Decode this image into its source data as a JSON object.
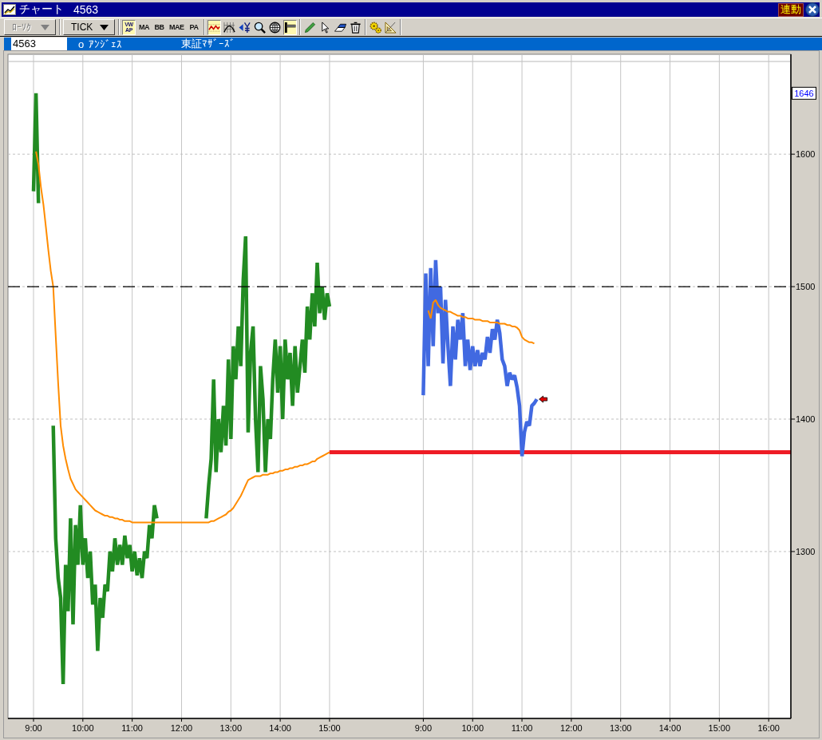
{
  "window": {
    "title": "チャート",
    "code": "4563",
    "link_badge": "連動"
  },
  "toolbar": {
    "dropdowns": [
      {
        "label": "ﾛｰｿｸ",
        "disabled": true
      },
      {
        "label": "TICK",
        "disabled": false
      }
    ],
    "indicators": [
      {
        "label": "VWAP",
        "selected": true
      },
      {
        "label": "MA",
        "selected": false
      },
      {
        "label": "BB",
        "selected": false
      },
      {
        "label": "MAE",
        "selected": false
      },
      {
        "label": "PA",
        "selected": false
      }
    ],
    "chart_tools": [
      {
        "selected": true
      },
      {
        "selected": false
      },
      {
        "selected": false
      },
      {
        "selected": false
      },
      {
        "selected": false
      },
      {
        "selected": true
      }
    ]
  },
  "symbol_bar": {
    "code": "4563",
    "mark": "o",
    "name": "ｱﾝｼﾞｪｽ",
    "market": "東証ﾏｻﾞｰｽﾞ"
  },
  "chart": {
    "price_tag": "1646",
    "chart_data": {
      "type": "line",
      "grid": true,
      "categories": [
        "9:00",
        null,
        null,
        null,
        null,
        null,
        null,
        null,
        null,
        null,
        null,
        null,
        null,
        null,
        null,
        null,
        null,
        null,
        null,
        null,
        "10:00",
        null,
        null,
        null,
        null,
        null,
        null,
        null,
        null,
        null,
        null,
        null,
        null,
        null,
        null,
        null,
        null,
        null,
        null,
        null,
        "11:00",
        null,
        null,
        null,
        null,
        null,
        null,
        null,
        null,
        null,
        null,
        null,
        null,
        null,
        null,
        null,
        null,
        null,
        null,
        null,
        "12:00",
        null,
        null,
        null,
        null,
        null,
        null,
        null,
        null,
        null,
        null,
        null,
        null,
        null,
        null,
        null,
        null,
        null,
        null,
        null,
        "13:00",
        null,
        null,
        null,
        null,
        null,
        null,
        null,
        null,
        null,
        null,
        null,
        null,
        null,
        null,
        null,
        null,
        null,
        null,
        null,
        "14:00",
        null,
        null,
        null,
        null,
        null,
        null,
        null,
        null,
        null,
        null,
        null,
        null,
        null,
        null,
        null,
        null,
        null,
        null,
        null,
        "15:00",
        null,
        null,
        null,
        null,
        null,
        null,
        null,
        null,
        null,
        null,
        null,
        null,
        null,
        null,
        null,
        null,
        null,
        null,
        null,
        null,
        null,
        null,
        null,
        null,
        null,
        null,
        null,
        null,
        null,
        null,
        null,
        null,
        null,
        null,
        null,
        null,
        null,
        "9:00",
        null,
        null,
        null,
        null,
        null,
        null,
        null,
        null,
        null,
        null,
        null,
        null,
        null,
        null,
        null,
        null,
        null,
        null,
        null,
        "10:00",
        null,
        null,
        null,
        null,
        null,
        null,
        null,
        null,
        null,
        null,
        null,
        null,
        null,
        null,
        null,
        null,
        null,
        null,
        null,
        "11:00",
        null,
        null,
        null,
        null,
        null,
        null,
        null,
        null,
        null,
        null,
        null,
        null,
        null,
        null,
        null,
        null,
        null,
        null,
        null,
        "12:00",
        null,
        null,
        null,
        null,
        null,
        null,
        null,
        null,
        null,
        null,
        null,
        null,
        null,
        null,
        null,
        null,
        null,
        null,
        null,
        "13:00",
        null,
        null,
        null,
        null,
        null,
        null,
        null,
        null,
        null,
        null,
        null,
        null,
        null,
        null,
        null,
        null,
        null,
        null,
        null,
        "14:00",
        null,
        null,
        null,
        null,
        null,
        null,
        null,
        null,
        null,
        null,
        null,
        null,
        null,
        null,
        null,
        null,
        null,
        null,
        null,
        "15:00",
        null,
        null,
        null,
        null,
        null,
        null,
        null,
        null,
        null,
        null,
        null,
        null,
        null,
        null,
        null,
        null,
        null,
        null,
        null,
        "16:00",
        null,
        null,
        null,
        null,
        null,
        null,
        null,
        null,
        null
      ],
      "ylim": [
        1174,
        1670
      ],
      "yticks": [
        1300,
        1400,
        1500,
        1600
      ],
      "series": [
        {
          "color": "#228b22",
          "values": [
            1572,
            1646,
            1563,
            null,
            null,
            null,
            null,
            null,
            1395,
            1310,
            1280,
            1265,
            1200,
            1290,
            1255,
            1325,
            1245,
            1320,
            1290,
            1335,
            1290,
            1310,
            1280,
            1300,
            1260,
            1275,
            1225,
            1265,
            1250,
            1275,
            1270,
            1300,
            1285,
            1310,
            1290,
            1305,
            1290,
            1312,
            1295,
            1305,
            1285,
            1300,
            1282,
            1295,
            1280,
            1300,
            1295,
            1320,
            1310,
            1335,
            1325,
            null,
            null,
            null,
            null,
            null,
            null,
            null,
            null,
            null,
            null,
            null,
            null,
            null,
            null,
            null,
            null,
            null,
            null,
            null,
            1325,
            1350,
            1370,
            1430,
            1360,
            1400,
            1375,
            1410,
            1380,
            1445,
            1385,
            1455,
            1430,
            1470,
            1440,
            1505,
            1538,
            1390,
            1450,
            1470,
            1400,
            1360,
            1440,
            1415,
            1360,
            1400,
            1385,
            1430,
            1460,
            1420,
            1455,
            1400,
            1460,
            1430,
            1450,
            1410,
            1455,
            1420,
            1440,
            1460,
            1435,
            1485,
            1460,
            1495,
            1470,
            1518,
            1480,
            1500,
            1475,
            1495,
            1485,
            null,
            null,
            null,
            null,
            null,
            null,
            null,
            null,
            null,
            null,
            null,
            null,
            null,
            null,
            null,
            null,
            null,
            null,
            null,
            null,
            null,
            null,
            null,
            null,
            null,
            null,
            null,
            null,
            null,
            null,
            null,
            null,
            null,
            null,
            null,
            null,
            null,
            null,
            null,
            null,
            null,
            null,
            null,
            null,
            null,
            null,
            null,
            null,
            null,
            null,
            null,
            null,
            null,
            null,
            null,
            null,
            null,
            null,
            null,
            null,
            null,
            null,
            null,
            null,
            null,
            null,
            null,
            null,
            null,
            null,
            null,
            null,
            null,
            null,
            null,
            null,
            null,
            null,
            null,
            null,
            null,
            null,
            null,
            null,
            null,
            null,
            null,
            null,
            null,
            null,
            null,
            null,
            null,
            null,
            null,
            null,
            null,
            null,
            null,
            null,
            null,
            null,
            null,
            null,
            null,
            null,
            null,
            null,
            null,
            null,
            null,
            null,
            null,
            null,
            null,
            null,
            null,
            null,
            null,
            null,
            null,
            null,
            null,
            null,
            null,
            null,
            null,
            null,
            null,
            null,
            null,
            null,
            null,
            null,
            null,
            null,
            null,
            null,
            null,
            null,
            null,
            null,
            null,
            null,
            null,
            null,
            null,
            null,
            null,
            null,
            null,
            null,
            null,
            null,
            null,
            null,
            null,
            null,
            null,
            null,
            null,
            null,
            null,
            null,
            null,
            null,
            null,
            null,
            null,
            null,
            null,
            null,
            null,
            null,
            null,
            null,
            null,
            null,
            null,
            null,
            null,
            null,
            null,
            null,
            null,
            null,
            null
          ]
        },
        {
          "color": "#4169e1",
          "values": [
            null,
            null,
            null,
            null,
            null,
            null,
            null,
            null,
            null,
            null,
            null,
            null,
            null,
            null,
            null,
            null,
            null,
            null,
            null,
            null,
            null,
            null,
            null,
            null,
            null,
            null,
            null,
            null,
            null,
            null,
            null,
            null,
            null,
            null,
            null,
            null,
            null,
            null,
            null,
            null,
            null,
            null,
            null,
            null,
            null,
            null,
            null,
            null,
            null,
            null,
            null,
            null,
            null,
            null,
            null,
            null,
            null,
            null,
            null,
            null,
            null,
            null,
            null,
            null,
            null,
            null,
            null,
            null,
            null,
            null,
            null,
            null,
            null,
            null,
            null,
            null,
            null,
            null,
            null,
            null,
            null,
            null,
            null,
            null,
            null,
            null,
            null,
            null,
            null,
            null,
            null,
            null,
            null,
            null,
            null,
            null,
            null,
            null,
            null,
            null,
            null,
            null,
            null,
            null,
            null,
            null,
            null,
            null,
            null,
            null,
            null,
            null,
            null,
            null,
            null,
            null,
            null,
            null,
            null,
            null,
            null,
            null,
            null,
            null,
            null,
            null,
            null,
            null,
            null,
            null,
            null,
            null,
            null,
            null,
            null,
            null,
            null,
            null,
            null,
            null,
            null,
            null,
            null,
            null,
            null,
            null,
            null,
            null,
            null,
            null,
            null,
            null,
            null,
            null,
            null,
            null,
            null,
            null,
            1418,
            1510,
            1440,
            1514,
            1455,
            1520,
            1480,
            1500,
            1442,
            1490,
            1455,
            1425,
            1470,
            1445,
            1475,
            1460,
            1480,
            1440,
            1460,
            1437,
            1455,
            1440,
            1452,
            1440,
            1450,
            1445,
            1462,
            1450,
            1468,
            1460,
            1475,
            1465,
            1445,
            1440,
            1425,
            1435,
            1430,
            1433,
            1424,
            1410,
            1372,
            1390,
            1398,
            1395,
            1410,
            1412,
            1415,
            null,
            null,
            null,
            null,
            null,
            null,
            null,
            null,
            null,
            null,
            null,
            null,
            null,
            null,
            null,
            null,
            null,
            null,
            null,
            null,
            null,
            null,
            null,
            null,
            null,
            null,
            null,
            null,
            null,
            null,
            null,
            null,
            null,
            null,
            null,
            null,
            null,
            null,
            null,
            null,
            null,
            null,
            null,
            null,
            null,
            null,
            null,
            null,
            null,
            null,
            null,
            null,
            null,
            null,
            null,
            null,
            null,
            null,
            null,
            null,
            null,
            null,
            null,
            null,
            null,
            null,
            null,
            null,
            null,
            null,
            null,
            null,
            null,
            null,
            null,
            null,
            null,
            null,
            null,
            null,
            null,
            null,
            null,
            null,
            null,
            null,
            null,
            null,
            null,
            null,
            null,
            null,
            null,
            null,
            null,
            null,
            null,
            null,
            null,
            null,
            null,
            null,
            null
          ]
        },
        {
          "color": "#ff8c00",
          "values": [
            null,
            1602,
            1592,
            1575,
            1562,
            1545,
            1528,
            1512,
            1500,
            1463,
            1427,
            1395,
            1380,
            1370,
            1362,
            1355,
            1351,
            1347,
            1345,
            1343,
            1341,
            1339,
            1337,
            1335,
            1333,
            1331,
            1330,
            1329,
            1328,
            1327,
            1327,
            1326,
            1326,
            1325,
            1325,
            1324,
            1324,
            1323,
            1323,
            1323,
            1322,
            1322,
            1322,
            1322,
            1322,
            1322,
            1322,
            1322,
            1322,
            1322,
            1322,
            1322,
            1322,
            1322,
            1322,
            1322,
            1322,
            1322,
            1322,
            1322,
            1322,
            1322,
            1322,
            1322,
            1322,
            1322,
            1322,
            1322,
            1322,
            1322,
            1322,
            1322,
            1323,
            1323,
            1324,
            1325,
            1326,
            1327,
            1328,
            1330,
            1331,
            1333,
            1336,
            1339,
            1342,
            1346,
            1350,
            1354,
            1355,
            1356,
            1357,
            1357,
            1357,
            1358,
            1358,
            1358,
            1359,
            1359,
            1360,
            1360,
            1361,
            1361,
            1362,
            1362,
            1363,
            1363,
            1364,
            1364,
            1365,
            1365,
            1366,
            1366,
            1367,
            1368,
            1368,
            1370,
            1371,
            1372,
            1373,
            1374,
            1375,
            null,
            null,
            null,
            null,
            null,
            null,
            null,
            null,
            null,
            null,
            null,
            null,
            null,
            null,
            null,
            null,
            null,
            null,
            null,
            null,
            null,
            null,
            null,
            null,
            null,
            null,
            null,
            null,
            null,
            null,
            null,
            null,
            null,
            null,
            null,
            null,
            null,
            null,
            null,
            1482,
            1476,
            1488,
            1490,
            1486,
            1484,
            1483,
            1482,
            1481,
            1481,
            1480,
            1479,
            1478,
            1478,
            1477,
            1477,
            1476,
            1476,
            1476,
            1475,
            1475,
            1475,
            1474,
            1474,
            1474,
            1473,
            1473,
            1473,
            1473,
            1472,
            1472,
            1472,
            1471,
            1471,
            1470,
            1470,
            1469,
            1467,
            1462,
            1460,
            1459,
            1458,
            1458,
            1457,
            null,
            null,
            null,
            null,
            null,
            null,
            null,
            null,
            null,
            null,
            null,
            null,
            null,
            null,
            null,
            null,
            null,
            null,
            null,
            null,
            null,
            null,
            null,
            null,
            null,
            null,
            null,
            null,
            null,
            null,
            null,
            null,
            null,
            null,
            null,
            null,
            null,
            null,
            null,
            null,
            null,
            null,
            null,
            null,
            null,
            null,
            null,
            null,
            null,
            null,
            null,
            null,
            null,
            null,
            null,
            null,
            null,
            null,
            null,
            null,
            null,
            null,
            null,
            null,
            null,
            null,
            null,
            null,
            null,
            null,
            null,
            null,
            null,
            null,
            null,
            null,
            null,
            null,
            null,
            null,
            null,
            null,
            null,
            null,
            null,
            null,
            null,
            null,
            null,
            null,
            null,
            null,
            null,
            null,
            null,
            null,
            null,
            null,
            null,
            null,
            null,
            null,
            null,
            null
          ]
        },
        {
          "color": "#ee1c25",
          "values": [
            null,
            null,
            null,
            null,
            null,
            null,
            null,
            null,
            null,
            null,
            null,
            null,
            null,
            null,
            null,
            null,
            null,
            null,
            null,
            null,
            null,
            null,
            null,
            null,
            null,
            null,
            null,
            null,
            null,
            null,
            null,
            null,
            null,
            null,
            null,
            null,
            null,
            null,
            null,
            null,
            null,
            null,
            null,
            null,
            null,
            null,
            null,
            null,
            null,
            null,
            null,
            null,
            null,
            null,
            null,
            null,
            null,
            null,
            null,
            null,
            null,
            null,
            null,
            null,
            null,
            null,
            null,
            null,
            null,
            null,
            null,
            null,
            null,
            null,
            null,
            null,
            null,
            null,
            null,
            null,
            null,
            null,
            null,
            null,
            null,
            null,
            null,
            null,
            null,
            null,
            null,
            null,
            null,
            null,
            null,
            null,
            null,
            null,
            null,
            null,
            null,
            null,
            null,
            null,
            null,
            null,
            null,
            null,
            null,
            null,
            null,
            null,
            null,
            null,
            null,
            null,
            null,
            null,
            null,
            null,
            1375,
            1375,
            1375,
            1375,
            1375,
            1375,
            1375,
            1375,
            1375,
            1375,
            1375,
            1375,
            1375,
            1375,
            1375,
            1375,
            1375,
            1375,
            1375,
            1375,
            1375,
            1375,
            1375,
            1375,
            1375,
            1375,
            1375,
            1375,
            1375,
            1375,
            1375,
            1375,
            1375,
            1375,
            1375,
            1375,
            1375,
            1375,
            1375,
            1375,
            1375,
            1375,
            1375,
            1375,
            1375,
            1375,
            1375,
            1375,
            1375,
            1375,
            1375,
            1375,
            1375,
            1375,
            1375,
            1375,
            1375,
            1375,
            1375,
            1375,
            1375,
            1375,
            1375,
            1375,
            1375,
            1375,
            1375,
            1375,
            1375,
            1375,
            1375,
            1375,
            1375,
            1375,
            1375,
            1375,
            1375,
            1375,
            1375,
            1375,
            1375,
            1375,
            1375,
            1375,
            1375,
            1375,
            1375,
            1375,
            1375,
            1375,
            1375,
            1375,
            1375,
            1375,
            1375,
            1375,
            1375,
            1375,
            1375,
            1375,
            1375,
            1375,
            1375,
            1375,
            1375,
            1375,
            1375,
            1375,
            1375,
            1375,
            1375,
            1375,
            1375,
            1375,
            1375,
            1375,
            1375,
            1375,
            1375,
            1375,
            1375,
            1375,
            1375,
            1375,
            1375,
            1375,
            1375,
            1375,
            1375,
            1375,
            1375,
            1375,
            1375,
            1375,
            1375,
            1375,
            1375,
            1375,
            1375,
            1375,
            1375,
            1375,
            1375,
            1375,
            1375,
            1375,
            1375,
            1375,
            1375,
            1375,
            1375,
            1375,
            1375,
            1375,
            1375,
            1375,
            1375,
            1375,
            1375,
            1375,
            1375,
            1375,
            1375,
            1375,
            1375,
            1375,
            1375,
            1375,
            1375,
            1375,
            1375,
            1375,
            1375,
            1375,
            1375,
            1375,
            1375,
            1375,
            1375,
            1375,
            1375,
            1375,
            1375,
            1375,
            1375,
            1375,
            1375,
            1375
          ]
        },
        {
          "color": "#000000",
          "line_style": "dashed",
          "values": [
            1500,
            1500,
            1500,
            1500,
            1500,
            1500,
            1500,
            1500,
            1500,
            1500,
            1500,
            1500,
            1500,
            1500,
            1500,
            1500,
            1500,
            1500,
            1500,
            1500,
            1500,
            1500,
            1500,
            1500,
            1500,
            1500,
            1500,
            1500,
            1500,
            1500,
            1500,
            1500,
            1500,
            1500,
            1500,
            1500,
            1500,
            1500,
            1500,
            1500,
            1500,
            1500,
            1500,
            1500,
            1500,
            1500,
            1500,
            1500,
            1500,
            1500,
            1500,
            1500,
            1500,
            1500,
            1500,
            1500,
            1500,
            1500,
            1500,
            1500,
            1500,
            1500,
            1500,
            1500,
            1500,
            1500,
            1500,
            1500,
            1500,
            1500,
            1500,
            1500,
            1500,
            1500,
            1500,
            1500,
            1500,
            1500,
            1500,
            1500,
            1500,
            1500,
            1500,
            1500,
            1500,
            1500,
            1500,
            1500,
            1500,
            1500,
            1500,
            1500,
            1500,
            1500,
            1500,
            1500,
            1500,
            1500,
            1500,
            1500,
            1500,
            1500,
            1500,
            1500,
            1500,
            1500,
            1500,
            1500,
            1500,
            1500,
            1500,
            1500,
            1500,
            1500,
            1500,
            1500,
            1500,
            1500,
            1500,
            1500,
            1500,
            1500,
            1500,
            1500,
            1500,
            1500,
            1500,
            1500,
            1500,
            1500,
            1500,
            1500,
            1500,
            1500,
            1500,
            1500,
            1500,
            1500,
            1500,
            1500,
            1500,
            1500,
            1500,
            1500,
            1500,
            1500,
            1500,
            1500,
            1500,
            1500,
            1500,
            1500,
            1500,
            1500,
            1500,
            1500,
            1500,
            1500,
            1500,
            1500,
            1500,
            1500,
            1500,
            1500,
            1500,
            1500,
            1500,
            1500,
            1500,
            1500,
            1500,
            1500,
            1500,
            1500,
            1500,
            1500,
            1500,
            1500,
            1500,
            1500,
            1500,
            1500,
            1500,
            1500,
            1500,
            1500,
            1500,
            1500,
            1500,
            1500,
            1500,
            1500,
            1500,
            1500,
            1500,
            1500,
            1500,
            1500,
            1500,
            1500,
            1500,
            1500,
            1500,
            1500,
            1500,
            1500,
            1500,
            1500,
            1500,
            1500,
            1500,
            1500,
            1500,
            1500,
            1500,
            1500,
            1500,
            1500,
            1500,
            1500,
            1500,
            1500,
            1500,
            1500,
            1500,
            1500,
            1500,
            1500,
            1500,
            1500,
            1500,
            1500,
            1500,
            1500,
            1500,
            1500,
            1500,
            1500,
            1500,
            1500,
            1500,
            1500,
            1500,
            1500,
            1500,
            1500,
            1500,
            1500,
            1500,
            1500,
            1500,
            1500,
            1500,
            1500,
            1500,
            1500,
            1500,
            1500,
            1500,
            1500,
            1500,
            1500,
            1500,
            1500,
            1500,
            1500,
            1500,
            1500,
            1500,
            1500,
            1500,
            1500,
            1500,
            1500,
            1500,
            1500,
            1500,
            1500,
            1500,
            1500,
            1500,
            1500,
            1500,
            1500,
            1500,
            1500,
            1500,
            1500,
            1500,
            1500,
            1500,
            1500,
            1500,
            1500,
            1500,
            1500,
            1500,
            1500,
            1500,
            1500,
            1500,
            1500,
            1500,
            1500,
            1500,
            1500,
            1500,
            1500
          ]
        }
      ]
    }
  }
}
